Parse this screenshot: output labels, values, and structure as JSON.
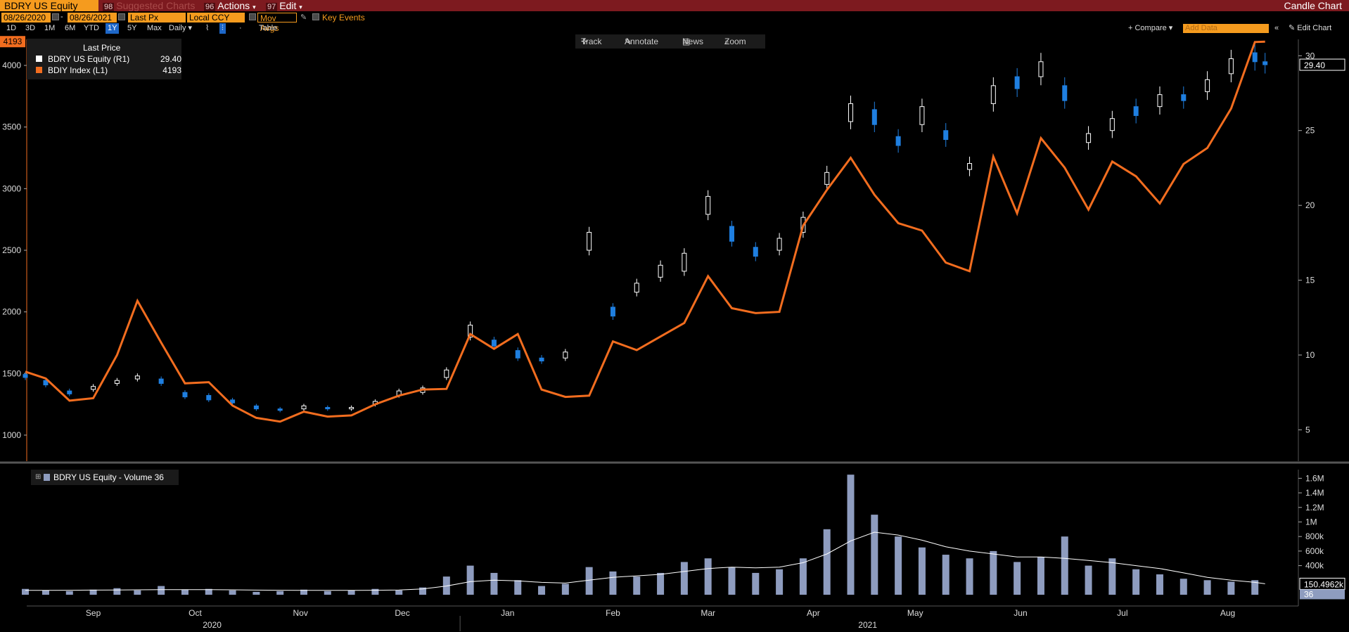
{
  "header": {
    "ticker": "BDRY US Equity",
    "suggested_num": "98",
    "suggested": "Suggested Charts",
    "actions_num": "96",
    "actions": "Actions",
    "edit_num": "97",
    "edit": "Edit",
    "chart_title": "Candle Chart"
  },
  "params": {
    "start_date": "08/26/2020",
    "dash": "-",
    "end_date": "08/26/2021",
    "price_field": "Last Px",
    "currency": "Local CCY",
    "mov_avgs": "Mov Avgs",
    "key_events": "Key Events"
  },
  "periods": [
    "1D",
    "3D",
    "1M",
    "6M",
    "YTD",
    "1Y",
    "5Y",
    "Max"
  ],
  "active_period": "1Y",
  "frequency": "Daily",
  "table_label": "Table",
  "toolbar": {
    "track": "Track",
    "annotate": "Annotate",
    "news": "News",
    "zoom": "Zoom"
  },
  "right_tools": {
    "compare": "Compare",
    "add_data": "Add Data",
    "edit_chart": "Edit Chart"
  },
  "legend": {
    "header": "Last Price",
    "items": [
      {
        "name": "BDRY US Equity  (R1)",
        "value": "29.40",
        "color": "#ffffff"
      },
      {
        "name": "BDIY Index  (L1)",
        "value": "4193",
        "color": "#f26d1f"
      }
    ]
  },
  "volume_legend": "BDRY US Equity - Volume 36",
  "axis_tags": {
    "left_last": "4193",
    "right_last": "29.40",
    "vol_ma": "150.4962k",
    "vol_last": "36"
  },
  "colors": {
    "bdiy": "#f26d1f",
    "up_candle": "#ffffff",
    "down_candle": "#1f7fe0",
    "volume": "#8e9cbf",
    "frame": "#7d1a1f",
    "accent": "#f59b1e"
  },
  "chart_data": [
    {
      "type": "line",
      "series_name": "BDIY Index (L1)",
      "x": [
        "2020-08-26",
        "2020-09-01",
        "2020-09-08",
        "2020-09-15",
        "2020-09-22",
        "2020-09-28",
        "2020-10-05",
        "2020-10-12",
        "2020-10-19",
        "2020-10-26",
        "2020-11-02",
        "2020-11-09",
        "2020-11-16",
        "2020-11-23",
        "2020-11-30",
        "2020-12-07",
        "2020-12-14",
        "2020-12-21",
        "2020-12-28",
        "2021-01-04",
        "2021-01-11",
        "2021-01-18",
        "2021-01-25",
        "2021-02-01",
        "2021-02-08",
        "2021-02-15",
        "2021-02-22",
        "2021-03-01",
        "2021-03-08",
        "2021-03-15",
        "2021-03-22",
        "2021-03-29",
        "2021-04-05",
        "2021-04-12",
        "2021-04-19",
        "2021-04-26",
        "2021-05-03",
        "2021-05-10",
        "2021-05-17",
        "2021-05-24",
        "2021-05-31",
        "2021-06-07",
        "2021-06-14",
        "2021-06-21",
        "2021-06-28",
        "2021-07-05",
        "2021-07-12",
        "2021-07-19",
        "2021-07-26",
        "2021-08-02",
        "2021-08-09",
        "2021-08-16",
        "2021-08-23",
        "2021-08-26"
      ],
      "y": [
        1515,
        1460,
        1280,
        1300,
        1650,
        2090,
        1750,
        1420,
        1430,
        1240,
        1140,
        1110,
        1190,
        1150,
        1160,
        1250,
        1320,
        1370,
        1375,
        1820,
        1700,
        1820,
        1370,
        1310,
        1320,
        1760,
        1690,
        1800,
        1910,
        2290,
        2030,
        1990,
        2000,
        2700,
        2990,
        3250,
        2950,
        2720,
        2660,
        2400,
        2330,
        3260,
        2800,
        3410,
        3170,
        2830,
        3220,
        3100,
        2880,
        3200,
        3330,
        3650,
        4190,
        4193
      ],
      "ylim": [
        800,
        4200
      ],
      "axis": "left",
      "ticks": [
        1000,
        1500,
        2000,
        2500,
        3000,
        3500,
        4000
      ]
    },
    {
      "type": "candlestick",
      "series_name": "BDRY US Equity (R1)",
      "x": [
        "2020-08-26",
        "2020-09-01",
        "2020-09-08",
        "2020-09-15",
        "2020-09-22",
        "2020-09-28",
        "2020-10-05",
        "2020-10-12",
        "2020-10-19",
        "2020-10-26",
        "2020-11-02",
        "2020-11-09",
        "2020-11-16",
        "2020-11-23",
        "2020-11-30",
        "2020-12-07",
        "2020-12-14",
        "2020-12-21",
        "2020-12-28",
        "2021-01-04",
        "2021-01-11",
        "2021-01-18",
        "2021-01-25",
        "2021-02-01",
        "2021-02-08",
        "2021-02-15",
        "2021-02-22",
        "2021-03-01",
        "2021-03-08",
        "2021-03-15",
        "2021-03-22",
        "2021-03-29",
        "2021-04-05",
        "2021-04-12",
        "2021-04-19",
        "2021-04-26",
        "2021-05-03",
        "2021-05-10",
        "2021-05-17",
        "2021-05-24",
        "2021-05-31",
        "2021-06-07",
        "2021-06-14",
        "2021-06-21",
        "2021-06-28",
        "2021-07-05",
        "2021-07-12",
        "2021-07-19",
        "2021-07-26",
        "2021-08-02",
        "2021-08-09",
        "2021-08-16",
        "2021-08-23",
        "2021-08-26"
      ],
      "close": [
        8.5,
        8.0,
        7.4,
        7.9,
        8.3,
        8.6,
        8.1,
        7.2,
        7.0,
        6.8,
        6.4,
        6.3,
        6.6,
        6.4,
        6.5,
        6.9,
        7.6,
        7.8,
        9.0,
        12.0,
        10.6,
        9.8,
        9.6,
        10.2,
        18.2,
        12.6,
        14.8,
        16.0,
        16.8,
        20.6,
        17.6,
        16.6,
        17.8,
        19.2,
        22.2,
        26.8,
        25.4,
        24.0,
        26.6,
        24.4,
        22.8,
        28.0,
        27.8,
        29.6,
        27.0,
        24.8,
        25.8,
        26.0,
        27.4,
        27.0,
        28.4,
        29.8,
        29.6,
        29.4
      ],
      "open": [
        8.7,
        8.3,
        7.6,
        7.7,
        8.1,
        8.4,
        8.4,
        7.5,
        7.3,
        7.0,
        6.6,
        6.4,
        6.4,
        6.5,
        6.4,
        6.7,
        7.3,
        7.5,
        8.5,
        11.2,
        11.0,
        10.3,
        9.8,
        9.8,
        17.0,
        13.2,
        14.2,
        15.2,
        15.6,
        19.4,
        18.6,
        17.2,
        17.0,
        18.2,
        21.4,
        25.6,
        26.4,
        24.6,
        25.4,
        25.0,
        22.4,
        26.8,
        28.6,
        28.6,
        28.0,
        24.2,
        25.0,
        26.6,
        26.6,
        27.4,
        27.6,
        28.8,
        30.2,
        29.6
      ],
      "ylim": [
        3,
        31
      ],
      "axis": "right",
      "ticks": [
        5,
        10,
        15,
        20,
        25,
        30
      ]
    },
    {
      "type": "bar",
      "series_name": "BDRY US Equity - Volume",
      "x": [
        "2020-08-26",
        "2020-09-01",
        "2020-09-08",
        "2020-09-15",
        "2020-09-22",
        "2020-09-28",
        "2020-10-05",
        "2020-10-12",
        "2020-10-19",
        "2020-10-26",
        "2020-11-02",
        "2020-11-09",
        "2020-11-16",
        "2020-11-23",
        "2020-11-30",
        "2020-12-07",
        "2020-12-14",
        "2020-12-21",
        "2020-12-28",
        "2021-01-04",
        "2021-01-11",
        "2021-01-18",
        "2021-01-25",
        "2021-02-01",
        "2021-02-08",
        "2021-02-15",
        "2021-02-22",
        "2021-03-01",
        "2021-03-08",
        "2021-03-15",
        "2021-03-22",
        "2021-03-29",
        "2021-04-05",
        "2021-04-12",
        "2021-04-19",
        "2021-04-26",
        "2021-05-03",
        "2021-05-10",
        "2021-05-17",
        "2021-05-24",
        "2021-05-31",
        "2021-06-07",
        "2021-06-14",
        "2021-06-21",
        "2021-06-28",
        "2021-07-05",
        "2021-07-12",
        "2021-07-19",
        "2021-07-26",
        "2021-08-02",
        "2021-08-09",
        "2021-08-16",
        "2021-08-23",
        "2021-08-26"
      ],
      "values": [
        80000,
        60000,
        50000,
        70000,
        90000,
        60000,
        120000,
        70000,
        80000,
        60000,
        40000,
        50000,
        70000,
        50000,
        60000,
        80000,
        60000,
        100000,
        250000,
        400000,
        300000,
        200000,
        120000,
        150000,
        380000,
        320000,
        250000,
        300000,
        450000,
        500000,
        380000,
        300000,
        350000,
        500000,
        900000,
        1650000,
        1100000,
        800000,
        650000,
        550000,
        500000,
        600000,
        450000,
        520000,
        800000,
        400000,
        500000,
        350000,
        280000,
        220000,
        200000,
        180000,
        200000,
        36
      ],
      "ma": [
        60000,
        60000,
        62000,
        64000,
        66000,
        68000,
        70000,
        70000,
        70000,
        68000,
        64000,
        62000,
        60000,
        60000,
        60000,
        62000,
        66000,
        80000,
        120000,
        180000,
        200000,
        190000,
        170000,
        160000,
        200000,
        240000,
        260000,
        280000,
        320000,
        360000,
        380000,
        370000,
        380000,
        440000,
        560000,
        740000,
        860000,
        820000,
        750000,
        660000,
        600000,
        560000,
        520000,
        520000,
        500000,
        470000,
        440000,
        400000,
        360000,
        300000,
        240000,
        200000,
        170000,
        150496
      ],
      "ylim": [
        0,
        1700000
      ],
      "axis": "right",
      "ticks": [
        "400k",
        "600k",
        "800k",
        "1M",
        "1.2M",
        "1.4M",
        "1.6M"
      ],
      "tick_values": [
        400000,
        600000,
        800000,
        1000000,
        1200000,
        1400000,
        1600000
      ]
    }
  ],
  "x_axis": {
    "months": [
      {
        "label": "Sep",
        "date": "2020-09-15"
      },
      {
        "label": "Oct",
        "date": "2020-10-15"
      },
      {
        "label": "Nov",
        "date": "2020-11-15"
      },
      {
        "label": "Dec",
        "date": "2020-12-15"
      },
      {
        "label": "Jan",
        "date": "2021-01-15"
      },
      {
        "label": "Feb",
        "date": "2021-02-15"
      },
      {
        "label": "Mar",
        "date": "2021-03-15"
      },
      {
        "label": "Apr",
        "date": "2021-04-15"
      },
      {
        "label": "May",
        "date": "2021-05-15"
      },
      {
        "label": "Jun",
        "date": "2021-06-15"
      },
      {
        "label": "Jul",
        "date": "2021-07-15"
      },
      {
        "label": "Aug",
        "date": "2021-08-15"
      }
    ],
    "years": [
      {
        "label": "2020",
        "date": "2020-10-20"
      },
      {
        "label": "2021",
        "date": "2021-05-01"
      }
    ],
    "range": [
      "2020-08-26",
      "2021-08-30"
    ]
  }
}
